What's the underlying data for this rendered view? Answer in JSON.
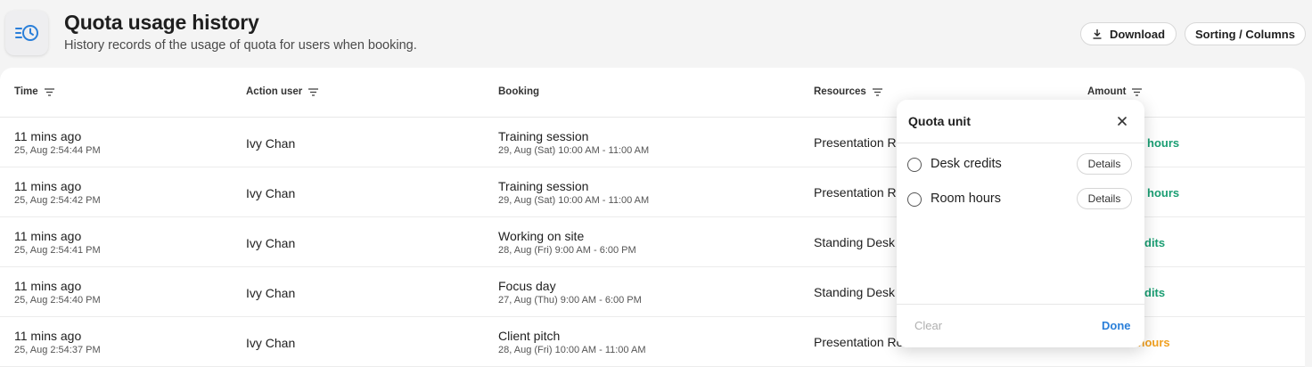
{
  "header": {
    "title": "Quota usage history",
    "subtitle": "History records of the usage of quota for users when booking.",
    "download_label": "Download",
    "sorting_label": "Sorting / Columns",
    "app_icon": "history-clock-icon"
  },
  "table": {
    "columns": {
      "time": "Time",
      "action_user": "Action user",
      "booking": "Booking",
      "resources": "Resources",
      "amount": "Amount"
    },
    "rows": [
      {
        "time": "11 mins ago",
        "time_detail": "25, Aug 2:54:44 PM",
        "user": "Ivy Chan",
        "booking": "Training session",
        "booking_detail": "29, Aug (Sat) 10:00 AM - 11:00 AM",
        "resource": "Presentation Ro",
        "amount": "hours",
        "amount_color": "#1a9e73"
      },
      {
        "time": "11 mins ago",
        "time_detail": "25, Aug 2:54:42 PM",
        "user": "Ivy Chan",
        "booking": "Training session",
        "booking_detail": "29, Aug (Sat) 10:00 AM - 11:00 AM",
        "resource": "Presentation Ro",
        "amount": "hours",
        "amount_color": "#1a9e73"
      },
      {
        "time": "11 mins ago",
        "time_detail": "25, Aug 2:54:41 PM",
        "user": "Ivy Chan",
        "booking": "Working on site",
        "booking_detail": "28, Aug (Fri) 9:00 AM - 6:00 PM",
        "resource": "Standing Desk",
        "amount": "dits",
        "amount_color": "#1a9e73"
      },
      {
        "time": "11 mins ago",
        "time_detail": "25, Aug 2:54:40 PM",
        "user": "Ivy Chan",
        "booking": "Focus day",
        "booking_detail": "27, Aug (Thu) 9:00 AM - 6:00 PM",
        "resource": "Standing Desk",
        "amount": "dits",
        "amount_color": "#1a9e73"
      },
      {
        "time": "11 mins ago",
        "time_detail": "25, Aug 2:54:37 PM",
        "user": "Ivy Chan",
        "booking": "Client pitch",
        "booking_detail": "28, Aug (Fri) 10:00 AM - 11:00 AM",
        "resource": "Presentation Ro",
        "amount": "n hours",
        "amount_color": "#f0a020"
      }
    ]
  },
  "popover": {
    "title": "Quota unit",
    "options": [
      {
        "label": "Desk credits",
        "details_label": "Details"
      },
      {
        "label": "Room hours",
        "details_label": "Details"
      }
    ],
    "clear_label": "Clear",
    "done_label": "Done"
  },
  "colors": {
    "accent": "#2a7fd9",
    "positive": "#1a9e73",
    "warning": "#f0a020"
  }
}
